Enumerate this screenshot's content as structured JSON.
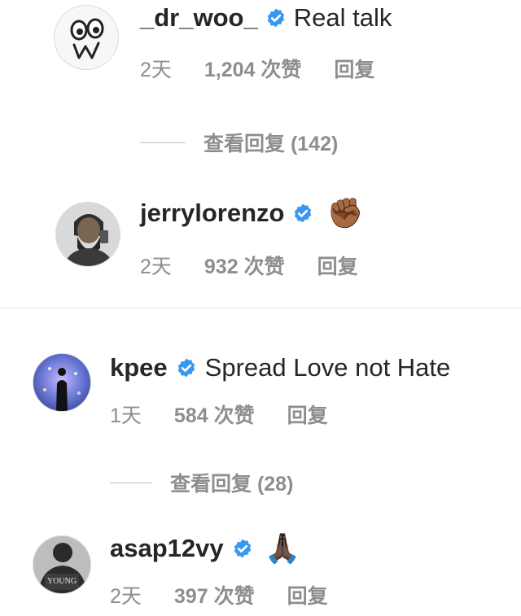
{
  "comments": [
    {
      "username": "_dr_woo_",
      "text": "Real talk",
      "time": "2天",
      "likes": "1,204 次赞",
      "reply": "回复",
      "view_replies": "查看回复 (142)"
    },
    {
      "username": "jerrylorenzo",
      "emoji": "✊🏾",
      "time": "2天",
      "likes": "932 次赞",
      "reply": "回复"
    },
    {
      "username": "kpee",
      "text": "Spread Love not Hate",
      "time": "1天",
      "likes": "584 次赞",
      "reply": "回复",
      "view_replies": "查看回复 (28)"
    },
    {
      "username": "asap12vy",
      "emoji": "🙏🏿",
      "time": "2天",
      "likes": "397 次赞",
      "reply": "回复"
    }
  ],
  "colors": {
    "verified": "#3897f0",
    "secondary_text": "#8e8e8e",
    "primary_text": "#262626"
  }
}
